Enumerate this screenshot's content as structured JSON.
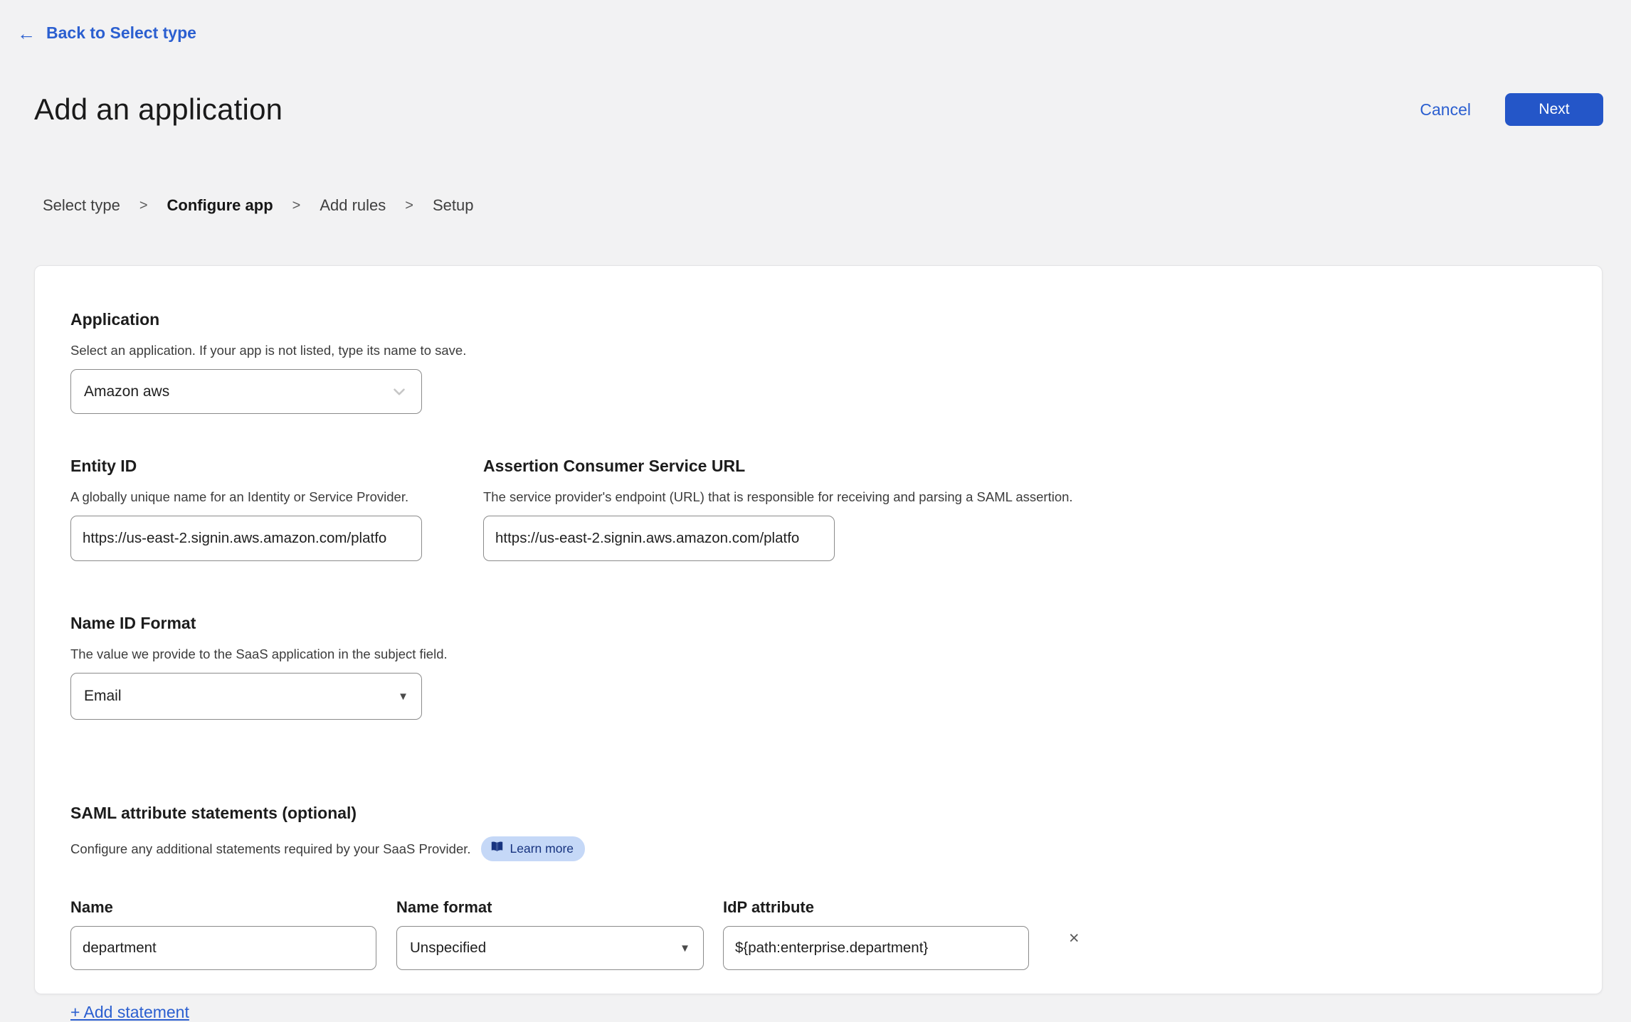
{
  "header": {
    "back_arrow": "←",
    "back_label": "Back to Select type",
    "title": "Add an application",
    "cancel_label": "Cancel",
    "next_label": "Next"
  },
  "breadcrumb": {
    "separator": ">",
    "items": [
      {
        "label": "Select type",
        "active": false
      },
      {
        "label": "Configure app",
        "active": true
      },
      {
        "label": "Add rules",
        "active": false
      },
      {
        "label": "Setup",
        "active": false
      }
    ]
  },
  "form": {
    "application": {
      "heading": "Application",
      "description": "Select an application. If your app is not listed, type its name to save.",
      "value": "Amazon aws"
    },
    "entity_id": {
      "heading": "Entity ID",
      "description": "A globally unique name for an Identity or Service Provider.",
      "value": "https://us-east-2.signin.aws.amazon.com/platfo"
    },
    "acs_url": {
      "heading": "Assertion Consumer Service URL",
      "description": "The service provider's endpoint (URL) that is responsible for receiving and parsing a SAML assertion.",
      "value": "https://us-east-2.signin.aws.amazon.com/platfo"
    },
    "name_id_format": {
      "heading": "Name ID Format",
      "description": "The value we provide to the SaaS application in the subject field.",
      "value": "Email"
    },
    "saml_attributes": {
      "heading": "SAML attribute statements (optional)",
      "description": "Configure any additional statements required by your SaaS Provider.",
      "learn_more_label": "Learn more",
      "name_label": "Name",
      "name_format_label": "Name format",
      "idp_attribute_label": "IdP attribute",
      "statement": {
        "name": "department",
        "name_format": "Unspecified",
        "idp_attribute": "${path:enterprise.department}"
      },
      "remove_symbol": "×",
      "add_statement_label": "+ Add statement"
    }
  },
  "colors": {
    "page_background": "#f2f2f3",
    "card_background": "#ffffff",
    "accent_button_blue": "#2456c8",
    "link_blue": "#2b5fd0",
    "learn_more_pill_bg": "#c5d8f7",
    "learn_more_pill_text": "#17337f",
    "input_border": "#8b8b8b"
  }
}
